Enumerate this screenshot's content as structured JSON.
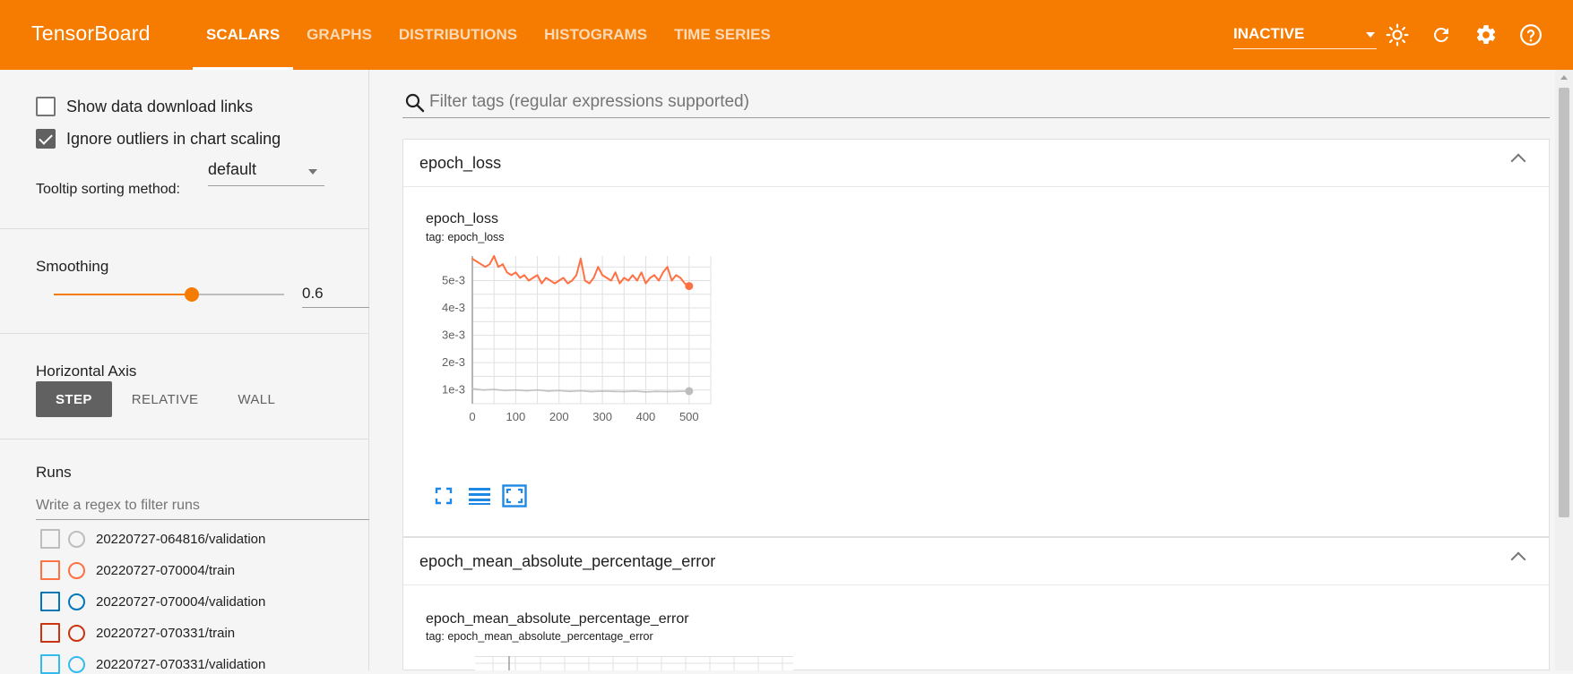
{
  "header": {
    "brand": "TensorBoard",
    "tabs": [
      {
        "label": "SCALARS",
        "active": true
      },
      {
        "label": "GRAPHS",
        "active": false
      },
      {
        "label": "DISTRIBUTIONS",
        "active": false
      },
      {
        "label": "HISTOGRAMS",
        "active": false
      },
      {
        "label": "TIME SERIES",
        "active": false
      }
    ],
    "run_state": "INACTIVE",
    "icons": [
      "brightness-icon",
      "refresh-icon",
      "settings-icon",
      "help-icon"
    ]
  },
  "sidebar": {
    "show_download_links": {
      "label": "Show data download links",
      "checked": false
    },
    "ignore_outliers": {
      "label": "Ignore outliers in chart scaling",
      "checked": true
    },
    "tooltip_sorting": {
      "label": "Tooltip sorting method:",
      "value": "default"
    },
    "smoothing": {
      "label": "Smoothing",
      "value": 0.6
    },
    "horizontal_axis": {
      "label": "Horizontal Axis",
      "options": [
        {
          "label": "STEP",
          "active": true
        },
        {
          "label": "RELATIVE",
          "active": false
        },
        {
          "label": "WALL",
          "active": false
        }
      ]
    },
    "runs": {
      "label": "Runs",
      "filter_placeholder": "Write a regex to filter runs",
      "items": [
        {
          "name": "20220727-064816/validation",
          "color": "#bdbdbd"
        },
        {
          "name": "20220727-070004/train",
          "color": "#ff7043"
        },
        {
          "name": "20220727-070004/validation",
          "color": "#0077bb"
        },
        {
          "name": "20220727-070331/train",
          "color": "#cc3311"
        },
        {
          "name": "20220727-070331/validation",
          "color": "#33bbee"
        }
      ]
    }
  },
  "main": {
    "filter_placeholder": "Filter tags (regular expressions supported)",
    "cards": [
      {
        "title": "epoch_loss",
        "chart_title": "epoch_loss",
        "chart_tag": "tag: epoch_loss"
      },
      {
        "title": "epoch_mean_absolute_percentage_error",
        "chart_title": "epoch_mean_absolute_percentage_error",
        "chart_tag": "tag: epoch_mean_absolute_percentage_error"
      }
    ]
  },
  "chart_data": {
    "type": "line",
    "title": "epoch_loss",
    "xlabel": "",
    "ylabel": "",
    "xlim": [
      0,
      550
    ],
    "ylim": [
      0.0005,
      0.0059
    ],
    "x_ticks": [
      {
        "value": 0,
        "label": "0"
      },
      {
        "value": 100,
        "label": "100"
      },
      {
        "value": 200,
        "label": "200"
      },
      {
        "value": 300,
        "label": "300"
      },
      {
        "value": 400,
        "label": "400"
      },
      {
        "value": 500,
        "label": "500"
      }
    ],
    "y_ticks": [
      {
        "value": 0.001,
        "label": "1e-3"
      },
      {
        "value": 0.002,
        "label": "2e-3"
      },
      {
        "value": 0.003,
        "label": "3e-3"
      },
      {
        "value": 0.004,
        "label": "4e-3"
      },
      {
        "value": 0.005,
        "label": "5e-3"
      }
    ],
    "grid": true,
    "series": [
      {
        "color": "#ff7043",
        "x": [
          0,
          10,
          20,
          30,
          40,
          50,
          60,
          70,
          80,
          90,
          100,
          110,
          120,
          130,
          140,
          150,
          160,
          170,
          180,
          190,
          200,
          210,
          220,
          230,
          240,
          250,
          260,
          270,
          280,
          290,
          300,
          310,
          320,
          330,
          340,
          350,
          360,
          370,
          380,
          390,
          400,
          410,
          420,
          430,
          440,
          450,
          460,
          470,
          480,
          490,
          500
        ],
        "y": [
          0.0058,
          0.0057,
          0.0056,
          0.0055,
          0.0056,
          0.0059,
          0.0055,
          0.0056,
          0.0053,
          0.0052,
          0.0053,
          0.0051,
          0.0052,
          0.005,
          0.0051,
          0.0052,
          0.0049,
          0.0051,
          0.005,
          0.0049,
          0.005,
          0.0051,
          0.0049,
          0.005,
          0.0052,
          0.0058,
          0.005,
          0.0049,
          0.0051,
          0.0055,
          0.0052,
          0.0051,
          0.005,
          0.0053,
          0.0049,
          0.0051,
          0.005,
          0.0052,
          0.005,
          0.0053,
          0.0049,
          0.0051,
          0.0052,
          0.005,
          0.0053,
          0.0055,
          0.005,
          0.0052,
          0.0051,
          0.0049,
          0.0048
        ]
      },
      {
        "color": "#bdbdbd",
        "x": [
          0,
          25,
          50,
          75,
          100,
          125,
          150,
          175,
          200,
          225,
          250,
          275,
          300,
          325,
          350,
          375,
          400,
          425,
          450,
          475,
          500
        ],
        "y": [
          0.00105,
          0.001,
          0.00102,
          0.00098,
          0.001,
          0.00097,
          0.001,
          0.00096,
          0.00098,
          0.00095,
          0.00097,
          0.00094,
          0.00096,
          0.00095,
          0.00094,
          0.00096,
          0.00093,
          0.00095,
          0.00094,
          0.00095,
          0.00096
        ]
      }
    ]
  }
}
